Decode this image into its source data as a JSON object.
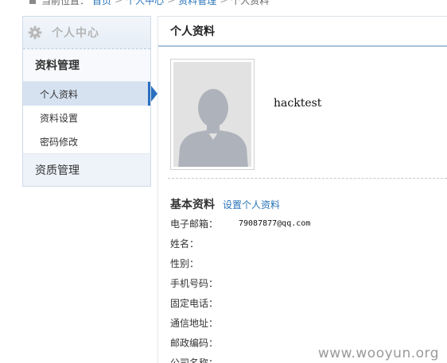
{
  "breadcrumb": {
    "prefix": "当前位置：",
    "items": [
      "首页",
      "个人中心",
      "资料管理",
      "个人资料"
    ],
    "separator": ">"
  },
  "sidebar": {
    "header": "个人中心",
    "group1": "资料管理",
    "items": [
      {
        "label": "个人资料",
        "active": true
      },
      {
        "label": "资料设置",
        "active": false
      },
      {
        "label": "密码修改",
        "active": false
      }
    ],
    "group2": "资质管理"
  },
  "main": {
    "title": "个人资料",
    "username": "hacktest",
    "basic": {
      "title": "基本资料",
      "link": "设置个人资料",
      "fields": [
        {
          "label": "电子邮箱：",
          "value": "79087877@qq.com"
        },
        {
          "label": "姓名：",
          "value": ""
        },
        {
          "label": "性别：",
          "value": ""
        },
        {
          "label": "手机号码：",
          "value": ""
        },
        {
          "label": "固定电话：",
          "value": ""
        },
        {
          "label": "通信地址：",
          "value": ""
        },
        {
          "label": "邮政编码：",
          "value": ""
        },
        {
          "label": "公司名称：",
          "value": ""
        }
      ]
    }
  },
  "watermark": "www.wooyun.org",
  "colors": {
    "link": "#2a74b8",
    "active_marker": "#2a6fc0",
    "active_bg": "#d7e2f1"
  },
  "icons": {
    "home": "home-icon",
    "gear": "gear-icon",
    "avatar_placeholder": "person-silhouette-icon"
  }
}
